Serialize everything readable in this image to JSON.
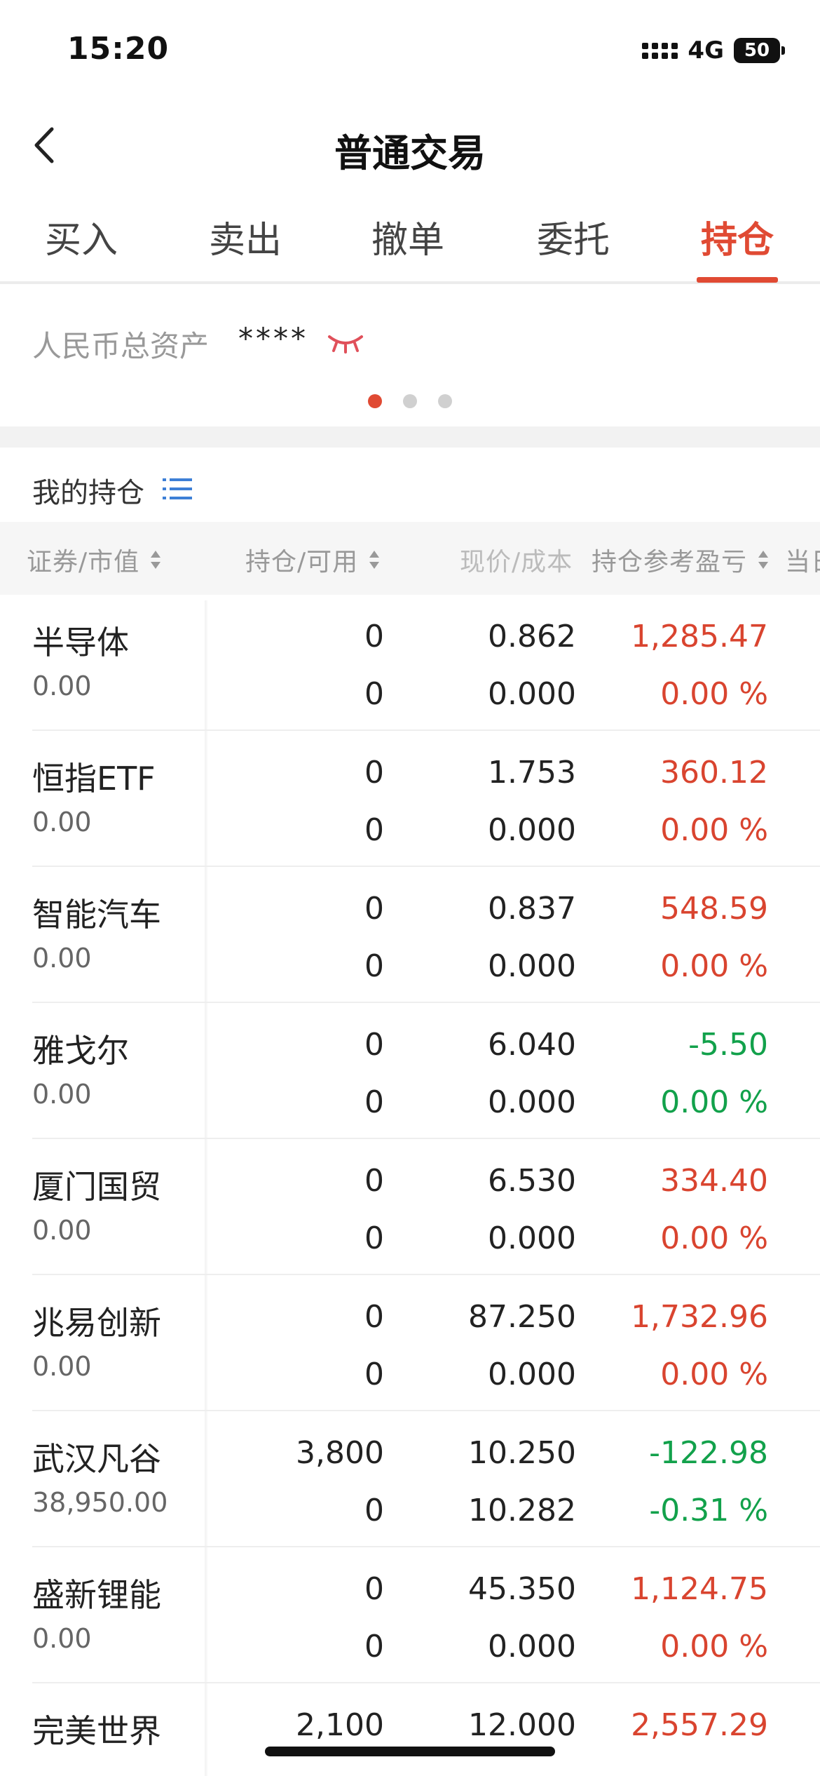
{
  "status_bar": {
    "time": "15:20",
    "network": "4G",
    "battery": "50"
  },
  "nav": {
    "title": "普通交易"
  },
  "tabs": [
    {
      "label": "买入",
      "active": false
    },
    {
      "label": "卖出",
      "active": false
    },
    {
      "label": "撤单",
      "active": false
    },
    {
      "label": "委托",
      "active": false
    },
    {
      "label": "持仓",
      "active": true
    }
  ],
  "asset": {
    "label": "人民币总资产",
    "value": "****"
  },
  "holdings": {
    "title": "我的持仓",
    "columns": [
      "证券/市值",
      "持仓/可用",
      "现价/成本",
      "持仓参考盈亏",
      "当日"
    ]
  },
  "colors": {
    "accent": "#e04a33",
    "gain": "#d9442f",
    "loss": "#12a14b"
  },
  "rows": [
    {
      "name": "半导体",
      "market_value": "0.00",
      "position": "0",
      "available": "0",
      "price": "0.862",
      "cost": "0.000",
      "pnl": "1,285.47",
      "pnl_pct": "0.00 %",
      "pnl_color": "red",
      "pct_color": "red"
    },
    {
      "name": "恒指ETF",
      "market_value": "0.00",
      "position": "0",
      "available": "0",
      "price": "1.753",
      "cost": "0.000",
      "pnl": "360.12",
      "pnl_pct": "0.00 %",
      "pnl_color": "red",
      "pct_color": "red"
    },
    {
      "name": "智能汽车",
      "market_value": "0.00",
      "position": "0",
      "available": "0",
      "price": "0.837",
      "cost": "0.000",
      "pnl": "548.59",
      "pnl_pct": "0.00 %",
      "pnl_color": "red",
      "pct_color": "red"
    },
    {
      "name": "雅戈尔",
      "market_value": "0.00",
      "position": "0",
      "available": "0",
      "price": "6.040",
      "cost": "0.000",
      "pnl": "-5.50",
      "pnl_pct": "0.00 %",
      "pnl_color": "green",
      "pct_color": "green"
    },
    {
      "name": "厦门国贸",
      "market_value": "0.00",
      "position": "0",
      "available": "0",
      "price": "6.530",
      "cost": "0.000",
      "pnl": "334.40",
      "pnl_pct": "0.00 %",
      "pnl_color": "red",
      "pct_color": "red"
    },
    {
      "name": "兆易创新",
      "market_value": "0.00",
      "position": "0",
      "available": "0",
      "price": "87.250",
      "cost": "0.000",
      "pnl": "1,732.96",
      "pnl_pct": "0.00 %",
      "pnl_color": "red",
      "pct_color": "red"
    },
    {
      "name": "武汉凡谷",
      "market_value": "38,950.00",
      "position": "3,800",
      "available": "0",
      "price": "10.250",
      "cost": "10.282",
      "pnl": "-122.98",
      "pnl_pct": "-0.31 %",
      "pnl_color": "green",
      "pct_color": "green"
    },
    {
      "name": "盛新锂能",
      "market_value": "0.00",
      "position": "0",
      "available": "0",
      "price": "45.350",
      "cost": "0.000",
      "pnl": "1,124.75",
      "pnl_pct": "0.00 %",
      "pnl_color": "red",
      "pct_color": "red"
    },
    {
      "name": "完美世界",
      "market_value": "",
      "position": "2,100",
      "available": "",
      "price": "12.000",
      "cost": "",
      "pnl": "2,557.29",
      "pnl_pct": "",
      "pnl_color": "red",
      "pct_color": "red"
    }
  ]
}
